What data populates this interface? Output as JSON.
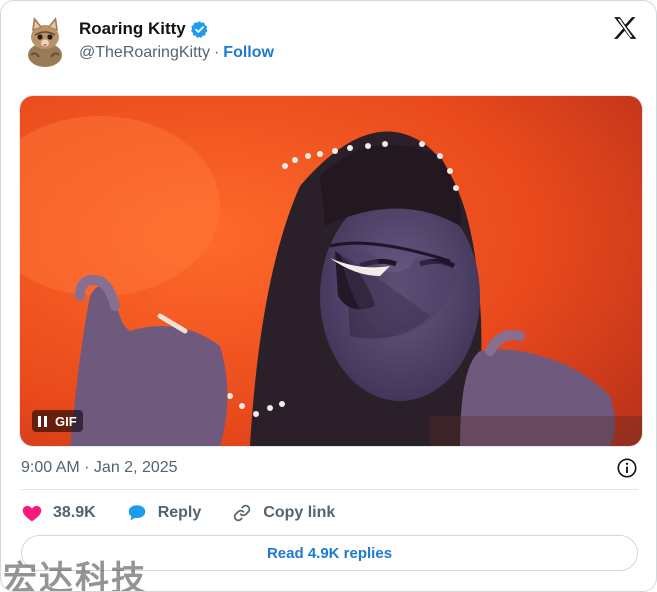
{
  "author": {
    "name": "Roaring Kitty",
    "handle": "@TheRoaringKitty",
    "separator": "·",
    "follow_label": "Follow",
    "avatar_icon": "kitten-avatar-icon",
    "verified_icon": "verified-badge-icon"
  },
  "platform_icon": "x-logo-icon",
  "media": {
    "type_badge": "GIF",
    "state_icon": "pause-icon"
  },
  "meta": {
    "timestamp": "9:00 AM · Jan 2, 2025",
    "info_icon": "info-icon"
  },
  "actions": {
    "likes_count": "38.9K",
    "reply_label": "Reply",
    "copy_link_label": "Copy link"
  },
  "read_replies_label": "Read 4.9K replies",
  "watermark": "宏达科技",
  "colors": {
    "like": "#f91880",
    "link": "#1d7bcf",
    "reply_icon": "#1d9bf0",
    "verified": "#1d9bf0",
    "secondary_text": "#536471"
  }
}
